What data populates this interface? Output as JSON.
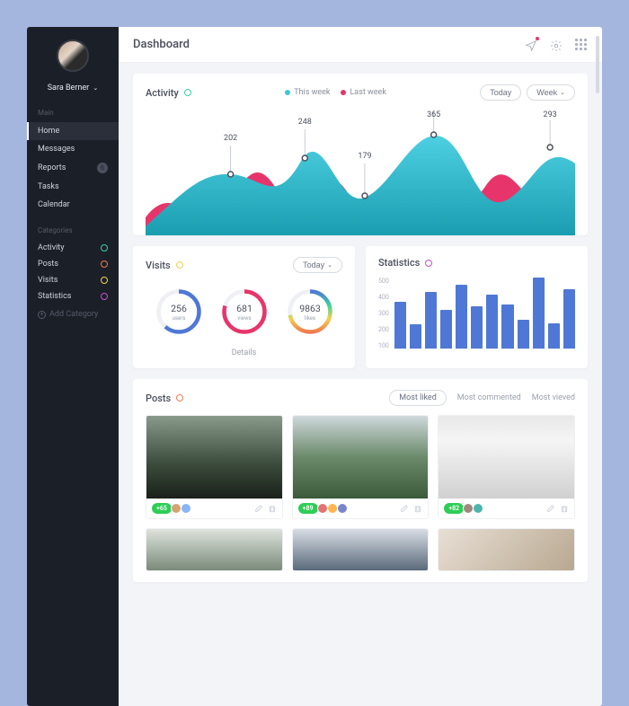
{
  "user": {
    "name": "Sara Berner"
  },
  "page_title": "Dashboard",
  "sidebar": {
    "main_label": "Main",
    "items": [
      {
        "label": "Home",
        "active": true
      },
      {
        "label": "Messages"
      },
      {
        "label": "Reports",
        "badge": "6"
      },
      {
        "label": "Tasks"
      },
      {
        "label": "Calendar"
      }
    ],
    "categories_label": "Categories",
    "categories": [
      {
        "label": "Activity",
        "color": "#3ad29f"
      },
      {
        "label": "Posts",
        "color": "#f27b4e"
      },
      {
        "label": "Visits",
        "color": "#f2d14e"
      },
      {
        "label": "Statistics",
        "color": "#c94fcf"
      }
    ],
    "add_category": "Add Category"
  },
  "activity": {
    "title": "Activity",
    "legend_this": "This week",
    "legend_last": "Last week",
    "btn_today": "Today",
    "btn_week": "Week",
    "dot_color": "#3ad29f"
  },
  "visits": {
    "title": "Visits",
    "btn_today": "Today",
    "dot_color": "#f2d14e",
    "rings": [
      {
        "value": "256",
        "label": "users"
      },
      {
        "value": "681",
        "label": "views"
      },
      {
        "value": "9863",
        "label": "likes"
      }
    ],
    "details": "Details"
  },
  "statistics": {
    "title": "Statistics",
    "dot_color": "#c94fcf",
    "y_ticks": [
      "500",
      "400",
      "300",
      "200",
      "100"
    ]
  },
  "posts": {
    "title": "Posts",
    "dot_color": "#f27b4e",
    "tab_liked": "Most liked",
    "tab_commented": "Most commented",
    "tab_viewed": "Most vieved",
    "items": [
      {
        "likes": "+65"
      },
      {
        "likes": "+89"
      },
      {
        "likes": "+82"
      }
    ]
  },
  "chart_data": {
    "activity": {
      "type": "area",
      "series": [
        {
          "name": "This week",
          "color": "#3fc6d6",
          "values": [
            202,
            248,
            179,
            365,
            293
          ]
        },
        {
          "name": "Last week",
          "color": "#e7356b",
          "values": [
            150,
            90,
            230,
            120,
            310,
            80,
            140
          ]
        }
      ],
      "peak_labels": [
        202,
        248,
        179,
        365,
        293
      ]
    },
    "statistics": {
      "type": "bar",
      "ylim": [
        0,
        500
      ],
      "values": [
        330,
        170,
        400,
        270,
        450,
        300,
        380,
        310,
        200,
        500,
        180,
        420
      ]
    },
    "visits_rings": [
      {
        "label": "users",
        "value": 256,
        "pct": 0.62,
        "stroke": "#4f78d6"
      },
      {
        "label": "views",
        "value": 681,
        "pct": 0.8,
        "stroke": "#e7356b"
      },
      {
        "label": "likes",
        "value": 9863,
        "pct": 0.72,
        "gradient": true
      }
    ]
  }
}
